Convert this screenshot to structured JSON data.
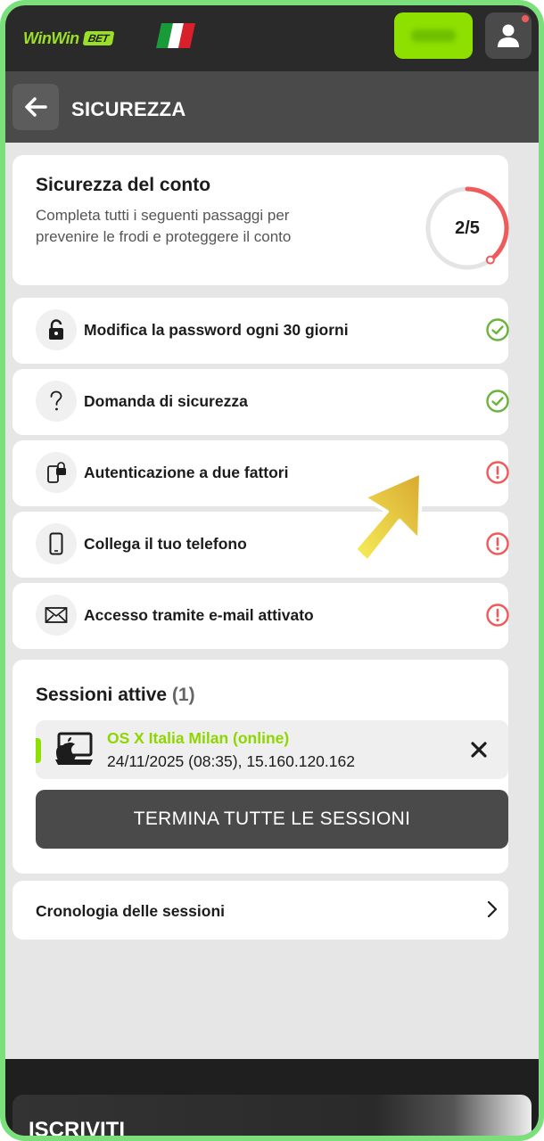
{
  "header": {
    "logo_text": "WinWin",
    "logo_badge": "BET",
    "flag": "italy-flag",
    "user_notification": true
  },
  "section": {
    "back_icon": "arrow-left-icon",
    "title": "SICUREZZA"
  },
  "summary": {
    "title": "Sicurezza del conto",
    "description": "Completa tutti i seguenti passaggi per prevenire le frodi e proteggere il conto",
    "progress_label": "2/5",
    "progress_fraction": 0.4
  },
  "steps": [
    {
      "label": "Modifica la password ogni 30 giorni",
      "icon": "lock-icon",
      "status": "done"
    },
    {
      "label": "Domanda di sicurezza",
      "icon": "question-icon",
      "status": "done"
    },
    {
      "label": "Autenticazione a due fattori",
      "icon": "phone-lock-icon",
      "status": "warning"
    },
    {
      "label": "Collega il tuo telefono",
      "icon": "phone-icon",
      "status": "warning"
    },
    {
      "label": "Accesso tramite e-mail attivato",
      "icon": "envelope-icon",
      "status": "warning"
    }
  ],
  "sessions": {
    "title": "Sessioni attive",
    "count": "(1)",
    "items": [
      {
        "name": "OS X Italia Milan (online)",
        "meta": "24/11/2025 (08:35), 15.160.120.162",
        "icon": "mac-device-icon"
      }
    ],
    "terminate_label": "TERMINA TUTTE LE SESSIONI"
  },
  "history": {
    "label": "Cronologia delle sessioni"
  },
  "footer": {
    "label": "ISCRIVITI"
  },
  "colors": {
    "accent": "#8ee000",
    "done": "#6cb33e",
    "warning": "#f05a5a",
    "progress_track": "#e4e4e4"
  }
}
